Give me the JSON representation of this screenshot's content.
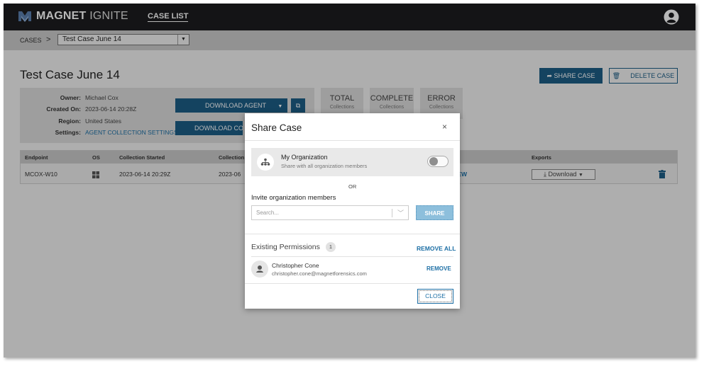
{
  "header": {
    "brand_bold": "MAGNET",
    "brand_light": "IGNITE",
    "nav_caselist": "CASE LIST"
  },
  "breadcrumb": {
    "cases": "CASES",
    "separator": ">",
    "selected_case": "Test Case June 14"
  },
  "case": {
    "title": "Test Case June 14",
    "share_label": "SHARE CASE",
    "delete_label": "DELETE CASE",
    "info": [
      {
        "label": "Owner:",
        "value": "Michael Cox"
      },
      {
        "label": "Created On:",
        "value": "2023-06-14 20:28Z"
      },
      {
        "label": "Region:",
        "value": "United States"
      },
      {
        "label": "Settings:",
        "value": "AGENT COLLECTION SETTINGS"
      }
    ],
    "download_agent_label": "DOWNLOAD AGENT",
    "download_cov_label": "DOWNLOAD COV",
    "stats": [
      {
        "title": "TOTAL",
        "sub": "Collections"
      },
      {
        "title": "COMPLETE",
        "sub": "Collections"
      },
      {
        "title": "ERROR",
        "sub": "Collections"
      }
    ]
  },
  "table": {
    "headers": [
      "Endpoint",
      "OS",
      "Collection Started",
      "Collection",
      "Exports"
    ],
    "row": {
      "endpoint": "MCOX-W10",
      "started": "2023-06-14 20:29Z",
      "collection": "2023-06",
      "review": "IEW",
      "download": "Download"
    }
  },
  "modal": {
    "title": "Share Case",
    "close_x": "×",
    "org_title": "My Organization",
    "org_sub": "Share with all organization members",
    "org_toggle_on": false,
    "or": "OR",
    "invite_label": "Invite organization members",
    "search_placeholder": "Search...",
    "share_button": "SHARE",
    "permissions_label": "Existing Permissions",
    "permissions_count": "1",
    "remove_all": "REMOVE ALL",
    "user_name": "Christopher Cone",
    "user_email": "christopher.cone@magnetforensics.com",
    "remove": "REMOVE",
    "close_button": "CLOSE"
  },
  "colors": {
    "accent": "#1d5d86",
    "link": "#1d6fa5",
    "topbar": "#1c1d1f"
  }
}
